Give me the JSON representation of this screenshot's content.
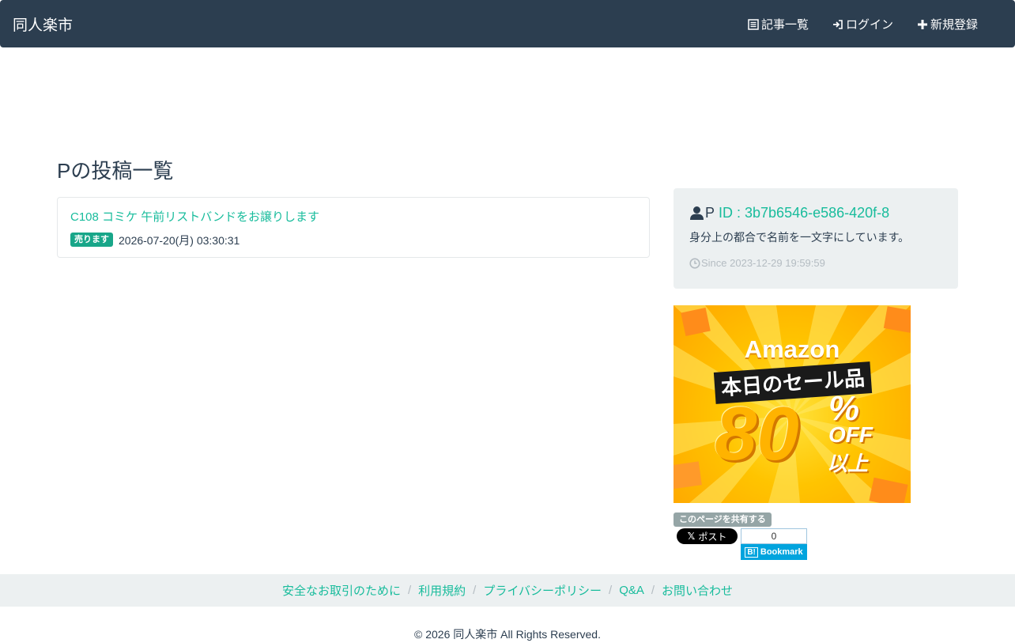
{
  "navbar": {
    "brand": "同人楽市",
    "items": [
      {
        "label": "記事一覧",
        "icon": "list-icon"
      },
      {
        "label": "ログイン",
        "icon": "login-icon"
      },
      {
        "label": "新規登録",
        "icon": "plus-icon"
      }
    ]
  },
  "main": {
    "page_title": "Pの投稿一覧",
    "posts": [
      {
        "title": "C108 コミケ 午前リストバンドをお譲りします",
        "badge": "売ります",
        "date": "2026-07-20(月) 03:30:31"
      }
    ]
  },
  "profile": {
    "name": "P",
    "id_text": "ID : 3b7b6546-e586-420f-8",
    "description": "身分上の都合で名前を一文字にしています。",
    "since": "Since 2023-12-29 19:59:59"
  },
  "ad": {
    "brand": "Amazon",
    "headline": "本日のセール品",
    "number": "80",
    "percent": "%",
    "off": "OFF",
    "suffix": "以上"
  },
  "share": {
    "label": "このページを共有する",
    "x_post": "ポスト",
    "hatena_count": "0",
    "hatena_label": "Bookmark"
  },
  "footer": {
    "links": [
      "安全なお取引のために",
      "利用規約",
      "プライバシーポリシー",
      "Q&A",
      "お問い合わせ"
    ],
    "copyright": "© 2026 同人楽市 All Rights Reserved."
  },
  "colors": {
    "navbar": "#2c3e50",
    "accent": "#18bc9c",
    "panel": "#ecf0f1",
    "badge": "#18a689"
  }
}
